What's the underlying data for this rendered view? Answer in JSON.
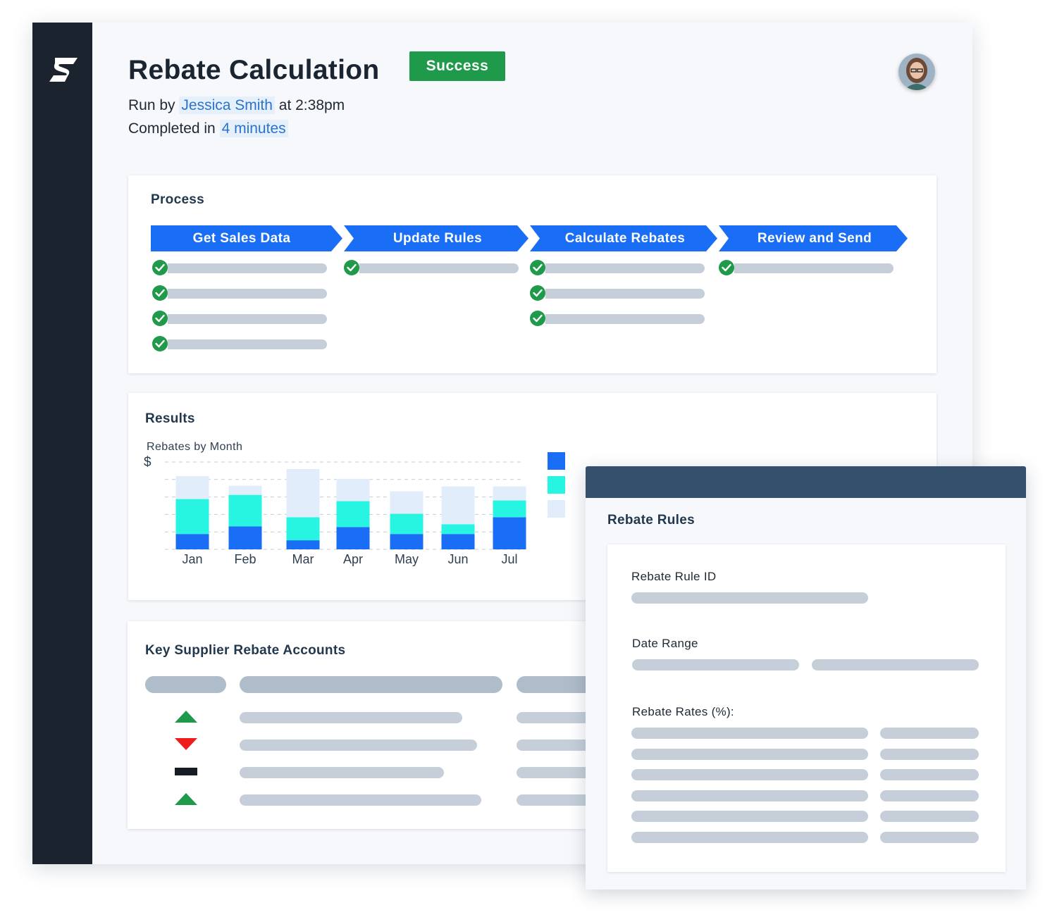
{
  "header": {
    "title": "Rebate Calculation",
    "status": "Success",
    "run_by_prefix": "Run by",
    "run_by_user": "Jessica Smith",
    "run_time": "at 2:38pm",
    "completed_prefix": "Completed in",
    "completed_duration": "4 minutes"
  },
  "process": {
    "title": "Process",
    "steps": [
      {
        "label": "Get Sales Data",
        "completed_tasks": 4
      },
      {
        "label": "Update Rules",
        "completed_tasks": 1
      },
      {
        "label": "Calculate Rebates",
        "completed_tasks": 3
      },
      {
        "label": "Review and Send",
        "completed_tasks": 1
      }
    ]
  },
  "results": {
    "title": "Results",
    "chart_title": "Rebates by Month"
  },
  "chart_data": {
    "type": "bar",
    "stacked": true,
    "title": "Rebates by Month",
    "ylabel": "$",
    "categories": [
      "Jan",
      "Feb",
      "Mar",
      "Apr",
      "May",
      "Jun",
      "Jul"
    ],
    "series": [
      {
        "color": "#1a6ef5",
        "values": [
          2.2,
          3.3,
          1.3,
          3.2,
          2.2,
          2.2,
          4.6
        ]
      },
      {
        "color": "#27f5e1",
        "values": [
          5.0,
          4.5,
          3.3,
          3.7,
          2.9,
          1.4,
          2.4
        ]
      },
      {
        "color": "#e1edfb",
        "values": [
          3.3,
          1.3,
          6.9,
          3.2,
          3.2,
          5.4,
          2.0
        ]
      }
    ],
    "ylim": [
      0,
      12.5
    ],
    "grid": true,
    "legend": "right"
  },
  "accounts": {
    "title": "Key Supplier Rebate Accounts",
    "trends": [
      "up",
      "down",
      "flat",
      "up"
    ]
  },
  "rules": {
    "title": "Rebate Rules",
    "field_rule_id": "Rebate Rule ID",
    "field_date_range": "Date Range",
    "field_rates": "Rebate Rates (%):"
  },
  "colors": {
    "sidebar": "#1a232e",
    "step_blue": "#1a6ef5",
    "success_green": "#1f9a4a",
    "down_red": "#ee1c1c",
    "modal_header": "#34506c"
  }
}
